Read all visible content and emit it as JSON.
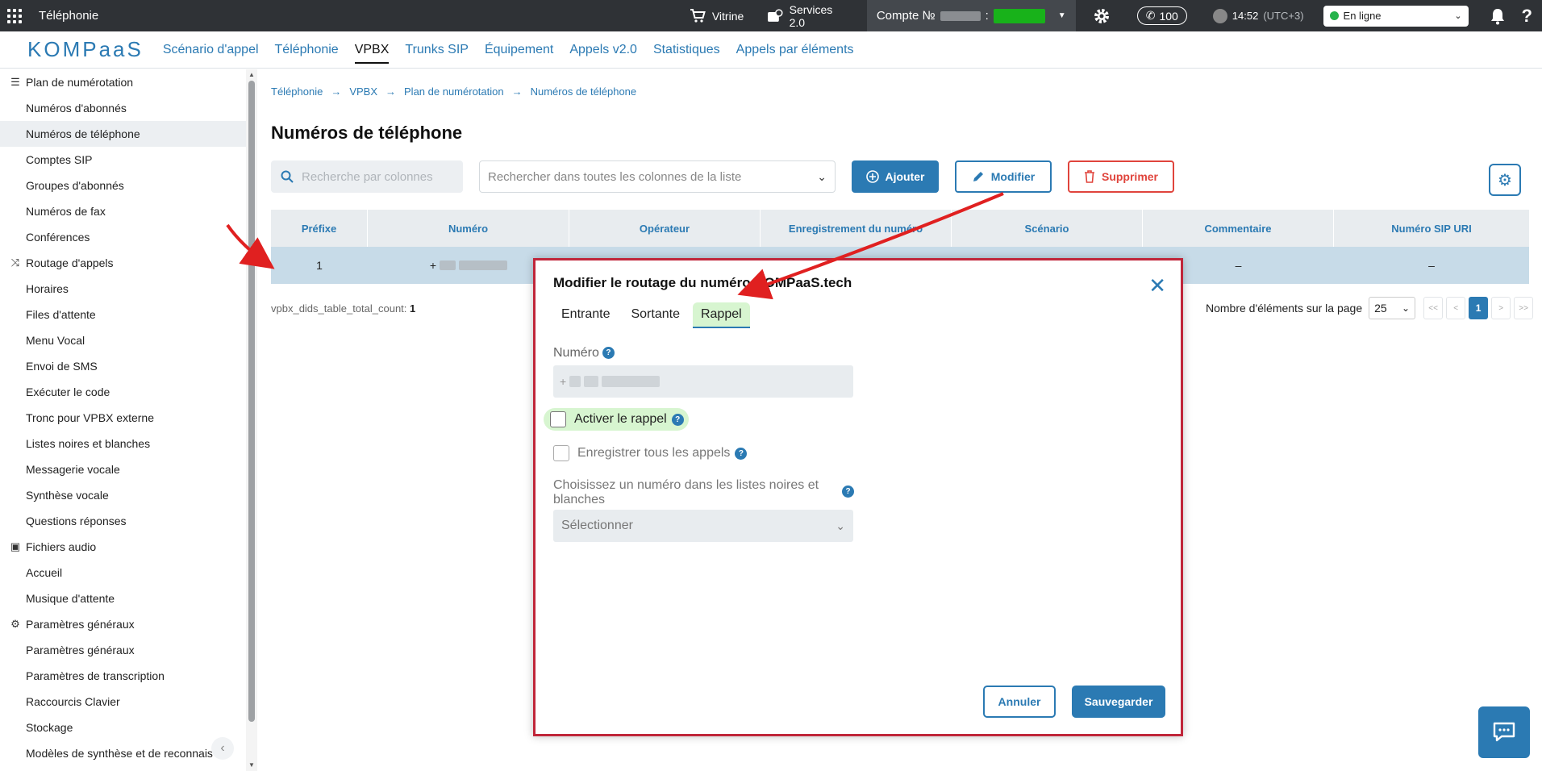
{
  "topbar": {
    "app_title": "Téléphonie",
    "vitrine": "Vitrine",
    "services": "Services 2.0",
    "compte_label": "Compte №",
    "compte_sep": ":",
    "calls_count": "100",
    "time": "14:52",
    "timezone": "(UTC+3)",
    "status": "En ligne",
    "help": "?"
  },
  "nav": {
    "logo": "KOMPaaS",
    "items": [
      "Scénario d'appel",
      "Téléphonie",
      "VPBX",
      "Trunks SIP",
      "Équipement",
      "Appels v2.0",
      "Statistiques",
      "Appels par éléments"
    ],
    "active": "VPBX"
  },
  "sidebar": {
    "sections": [
      {
        "label": "Plan de numérotation",
        "icon": "list-icon"
      },
      {
        "label": "Routage d'appels",
        "icon": "routing-icon"
      },
      {
        "label": "Fichiers audio",
        "icon": "audio-files-icon"
      },
      {
        "label": "Paramètres généraux",
        "icon": "gear-icon"
      }
    ],
    "items": [
      "Numéros d'abonnés",
      "Numéros de téléphone",
      "Comptes SIP",
      "Groupes d'abonnés",
      "Numéros de fax",
      "Conférences",
      "Horaires",
      "Files d'attente",
      "Menu Vocal",
      "Envoi de SMS",
      "Exécuter le code",
      "Tronc pour VPBX externe",
      "Listes noires et blanches",
      "Messagerie vocale",
      "Synthèse vocale",
      "Questions réponses",
      "Accueil",
      "Musique d'attente",
      "Paramètres généraux",
      "Paramètres de transcription",
      "Raccourcis Clavier",
      "Stockage",
      "Modèles de synthèse et de reconnais"
    ],
    "active": "Numéros de téléphone"
  },
  "breadcrumb": [
    "Téléphonie",
    "VPBX",
    "Plan de numérotation",
    "Numéros de téléphone"
  ],
  "page_title": "Numéros de téléphone",
  "toolbar": {
    "search_columns_placeholder": "Recherche par colonnes",
    "search_all_placeholder": "Rechercher dans toutes les colonnes de la liste",
    "add_label": "Ajouter",
    "edit_label": "Modifier",
    "delete_label": "Supprimer"
  },
  "table": {
    "columns": [
      "Préfixe",
      "Numéro",
      "Opérateur",
      "Enregistrement du numéro",
      "Scénario",
      "Commentaire",
      "Numéro SIP URI"
    ],
    "rows": [
      {
        "prefix": "1",
        "numero_prefix": "+",
        "operateur": "",
        "enregistrement": "",
        "scenario": "",
        "commentaire": "–",
        "sip_uri": "–"
      }
    ],
    "total_label": "vpbx_dids_table_total_count:",
    "total_value": "1"
  },
  "pagination": {
    "per_page_label": "Nombre d'éléments sur la page",
    "per_page_value": "25",
    "first": "<<",
    "prev": "<",
    "current": "1",
    "next": ">",
    "last": ">>"
  },
  "modal": {
    "title": "Modifier le routage du numéro KOMPaaS.tech",
    "tabs": [
      "Entrante",
      "Sortante",
      "Rappel"
    ],
    "active_tab": "Rappel",
    "numero_label": "Numéro",
    "numero_prefix": "+",
    "callback_label": "Activer le rappel",
    "callback_checked": false,
    "record_label": "Enregistrer tous les appels",
    "record_checked": false,
    "list_label": "Choisissez un numéro dans les listes noires et blanches",
    "list_placeholder": "Sélectionner",
    "cancel_label": "Annuler",
    "save_label": "Sauvegarder"
  },
  "colors": {
    "primary": "#2b7ab3",
    "danger": "#e0443c",
    "highlight_border": "#c0263a",
    "active_tab_bg": "#d7f5d0",
    "online": "#25b34b"
  }
}
